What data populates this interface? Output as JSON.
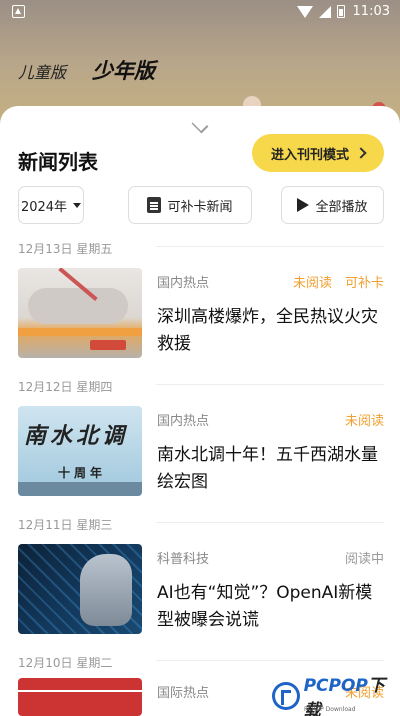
{
  "statusbar": {
    "time": "11:03"
  },
  "top_tabs": {
    "kids": "儿童版",
    "teen": "少年版"
  },
  "sheet": {
    "title": "新闻列表",
    "issue_mode_button": "进入刊刊模式"
  },
  "filters": {
    "year": "2024年",
    "makeup_news": "可补卡新闻",
    "play_all": "全部播放"
  },
  "news": [
    {
      "date": "12月13日 星期五",
      "category": "国内热点",
      "status": "未阅读",
      "extra": "可补卡",
      "title": "深圳高楼爆炸，全民热议火灾救援"
    },
    {
      "date": "12月12日 星期四",
      "category": "国内热点",
      "status": "未阅读",
      "title": "南水北调十年！五千西湖水量绘宏图",
      "thumb_text": "南水北调",
      "thumb_sub": "十周年"
    },
    {
      "date": "12月11日 星期三",
      "category": "科普科技",
      "status": "阅读中",
      "title": "AI也有“知觉”？OpenAI新模型被曝会说谎"
    },
    {
      "date": "12月10日 星期二",
      "category": "国际热点",
      "status": "未阅读"
    }
  ],
  "watermark": {
    "brand": "PCPOP",
    "suffix": "下载",
    "sub": "PCPOP Download"
  },
  "colors": {
    "accent_yellow": "#f6d84a",
    "status_orange": "#f0a030",
    "brand_blue": "#1e63c8"
  }
}
